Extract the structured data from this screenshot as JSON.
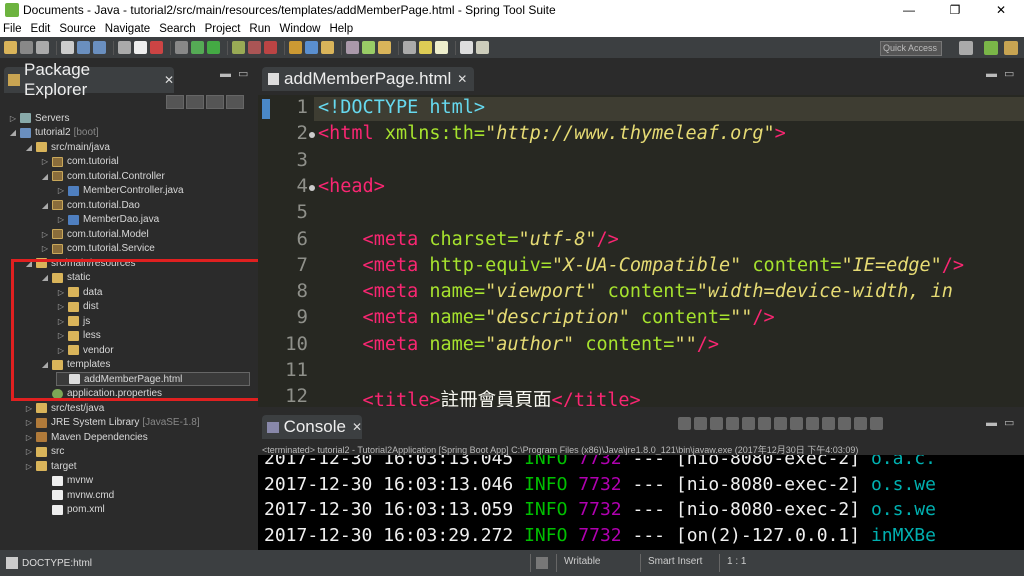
{
  "window": {
    "title": "Documents - Java - tutorial2/src/main/resources/templates/addMemberPage.html - Spring Tool Suite",
    "minimize": "—",
    "maximize": "❐",
    "close": "✕"
  },
  "menu": [
    "File",
    "Edit",
    "Source",
    "Navigate",
    "Search",
    "Project",
    "Run",
    "Window",
    "Help"
  ],
  "toolbar": {
    "quick_access": "Quick Access"
  },
  "package_explorer": {
    "title": "Package Explorer",
    "close": "✕",
    "items": [
      {
        "label": "Servers",
        "sub": "",
        "icon": "server-folder-icon",
        "arrow": "▷"
      },
      {
        "label": "tutorial2",
        "sub": "[boot]",
        "icon": "project-icon",
        "arrow": "◢"
      },
      {
        "label": "src/main/java",
        "sub": "",
        "icon": "source-folder-icon",
        "arrow": "◢"
      },
      {
        "label": "com.tutorial",
        "sub": "",
        "icon": "package-icon",
        "arrow": "▷"
      },
      {
        "label": "com.tutorial.Controller",
        "sub": "",
        "icon": "package-icon",
        "arrow": "◢"
      },
      {
        "label": "MemberController.java",
        "sub": "",
        "icon": "java-file-icon",
        "arrow": "▷"
      },
      {
        "label": "com.tutorial.Dao",
        "sub": "",
        "icon": "package-icon",
        "arrow": "◢"
      },
      {
        "label": "MemberDao.java",
        "sub": "",
        "icon": "java-file-icon",
        "arrow": "▷"
      },
      {
        "label": "com.tutorial.Model",
        "sub": "",
        "icon": "package-icon",
        "arrow": "▷"
      },
      {
        "label": "com.tutorial.Service",
        "sub": "",
        "icon": "package-icon",
        "arrow": "▷"
      },
      {
        "label": "src/main/resources",
        "sub": "",
        "icon": "source-folder-icon",
        "arrow": "◢"
      },
      {
        "label": "static",
        "sub": "",
        "icon": "folder-icon",
        "arrow": "◢"
      },
      {
        "label": "data",
        "sub": "",
        "icon": "folder-icon",
        "arrow": "▷"
      },
      {
        "label": "dist",
        "sub": "",
        "icon": "folder-icon",
        "arrow": "▷"
      },
      {
        "label": "js",
        "sub": "",
        "icon": "folder-icon",
        "arrow": "▷"
      },
      {
        "label": "less",
        "sub": "",
        "icon": "folder-icon",
        "arrow": "▷"
      },
      {
        "label": "vendor",
        "sub": "",
        "icon": "folder-icon",
        "arrow": "▷"
      },
      {
        "label": "templates",
        "sub": "",
        "icon": "folder-icon",
        "arrow": "◢"
      },
      {
        "label": "addMemberPage.html",
        "sub": "",
        "icon": "html-file-icon",
        "arrow": ""
      },
      {
        "label": "application.properties",
        "sub": "",
        "icon": "properties-file-icon",
        "arrow": ""
      },
      {
        "label": "src/test/java",
        "sub": "",
        "icon": "source-folder-icon",
        "arrow": "▷"
      },
      {
        "label": "JRE System Library",
        "sub": "[JavaSE-1.8]",
        "icon": "library-icon",
        "arrow": "▷"
      },
      {
        "label": "Maven Dependencies",
        "sub": "",
        "icon": "library-icon",
        "arrow": "▷"
      },
      {
        "label": "src",
        "sub": "",
        "icon": "folder-icon",
        "arrow": "▷"
      },
      {
        "label": "target",
        "sub": "",
        "icon": "folder-icon",
        "arrow": "▷"
      },
      {
        "label": "mvnw",
        "sub": "",
        "icon": "file-icon",
        "arrow": ""
      },
      {
        "label": "mvnw.cmd",
        "sub": "",
        "icon": "file-icon",
        "arrow": ""
      },
      {
        "label": "pom.xml",
        "sub": "",
        "icon": "xml-file-icon",
        "arrow": ""
      }
    ]
  },
  "editor": {
    "tab_label": "addMemberPage.html",
    "close": "✕",
    "line_numbers": [
      "1",
      "2",
      "3",
      "4",
      "5",
      "6",
      "7",
      "8",
      "9",
      "10",
      "11",
      "12"
    ],
    "lines": [
      [
        {
          "t": "<!DOCTYPE html>",
          "c": "dt"
        }
      ],
      [
        {
          "t": "<html ",
          "c": "tg"
        },
        {
          "t": "xmlns:th=",
          "c": "at"
        },
        {
          "t": "\"http://www.thymeleaf.org\"",
          "c": "st"
        },
        {
          "t": ">",
          "c": "tg"
        }
      ],
      [],
      [
        {
          "t": "<head>",
          "c": "tg"
        }
      ],
      [],
      [
        {
          "t": "    <meta ",
          "c": "tg"
        },
        {
          "t": "charset=",
          "c": "at"
        },
        {
          "t": "\"utf-8\"",
          "c": "st"
        },
        {
          "t": "/>",
          "c": "tg"
        }
      ],
      [
        {
          "t": "    <meta ",
          "c": "tg"
        },
        {
          "t": "http-equiv=",
          "c": "at"
        },
        {
          "t": "\"X-UA-Compatible\"",
          "c": "st"
        },
        {
          "t": " content=",
          "c": "at"
        },
        {
          "t": "\"IE=edge\"",
          "c": "st"
        },
        {
          "t": "/>",
          "c": "tg"
        }
      ],
      [
        {
          "t": "    <meta ",
          "c": "tg"
        },
        {
          "t": "name=",
          "c": "at"
        },
        {
          "t": "\"viewport\"",
          "c": "st"
        },
        {
          "t": " content=",
          "c": "at"
        },
        {
          "t": "\"width=device-width, in",
          "c": "st"
        }
      ],
      [
        {
          "t": "    <meta ",
          "c": "tg"
        },
        {
          "t": "name=",
          "c": "at"
        },
        {
          "t": "\"description\"",
          "c": "st"
        },
        {
          "t": " content=",
          "c": "at"
        },
        {
          "t": "\"\"",
          "c": "st"
        },
        {
          "t": "/>",
          "c": "tg"
        }
      ],
      [
        {
          "t": "    <meta ",
          "c": "tg"
        },
        {
          "t": "name=",
          "c": "at"
        },
        {
          "t": "\"author\"",
          "c": "st"
        },
        {
          "t": " content=",
          "c": "at"
        },
        {
          "t": "\"\"",
          "c": "st"
        },
        {
          "t": "/>",
          "c": "tg"
        }
      ],
      [],
      [
        {
          "t": "    <title>",
          "c": "tg"
        },
        {
          "t": "註冊會員頁面",
          "c": "wt"
        },
        {
          "t": "</title>",
          "c": "tg"
        }
      ]
    ]
  },
  "console": {
    "title": "Console",
    "close": "✕",
    "terminated": "<terminated> tutorial2 - Tutorial2Application [Spring Boot App] C:\\Program Files (x86)\\Java\\jre1.8.0_121\\bin\\javaw.exe (2017年12月30日 下午4:03:09)",
    "logs": [
      {
        "ts": "2017-12-30 16:03:13.045",
        "level": "INFO",
        "pid": "7732",
        "sep": "---",
        "thread": "[nio-8080-exec-2]",
        "cls": "o.a.c."
      },
      {
        "ts": "2017-12-30 16:03:13.046",
        "level": "INFO",
        "pid": "7732",
        "sep": "---",
        "thread": "[nio-8080-exec-2]",
        "cls": "o.s.we"
      },
      {
        "ts": "2017-12-30 16:03:13.059",
        "level": "INFO",
        "pid": "7732",
        "sep": "---",
        "thread": "[nio-8080-exec-2]",
        "cls": "o.s.we"
      },
      {
        "ts": "2017-12-30 16:03:29.272",
        "level": "INFO",
        "pid": "7732",
        "sep": "---",
        "thread": "[on(2)-127.0.0.1]",
        "cls": "inMXBe"
      }
    ]
  },
  "statusbar": {
    "path": "DOCTYPE:html",
    "writable": "Writable",
    "insert_mode": "Smart Insert",
    "position": "1 : 1"
  }
}
